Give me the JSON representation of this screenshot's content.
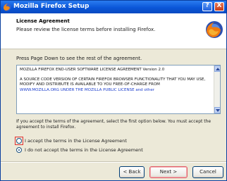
{
  "window": {
    "title": "Mozilla Firefox Setup",
    "help_glyph": "?",
    "close_glyph": "X"
  },
  "header": {
    "title": "License Agreement",
    "subtitle": "Please review the license terms before installing Firefox."
  },
  "intro": "Press Page Down to see the rest of the agreement.",
  "license": {
    "paragraphs": [
      "MOZILLA FIREFOX END-USER SOFTWARE LICENSE AGREEMENT Version 2.0",
      "A SOURCE CODE VERSION OF CERTAIN FIREFOX BROWSER FUNCTIONALITY THAT YOU MAY USE, MODIFY AND DISTRIBUTE IS AVAILABLE TO YOU FREE-OF-CHARGE FROM"
    ],
    "link_line": "WWW.MOZILLA.ORG UNDER THE MOZILLA PUBLIC LICENSE and other"
  },
  "note": "If you accept the terms of the agreement, select the first option below. You must accept the agreement to install Firefox.",
  "options": {
    "accept": "I accept the terms in the License Agreement",
    "decline": "I do not accept the terms in the License Agreement"
  },
  "buttons": {
    "back": "< Back",
    "next": "Next >",
    "cancel": "Cancel"
  }
}
